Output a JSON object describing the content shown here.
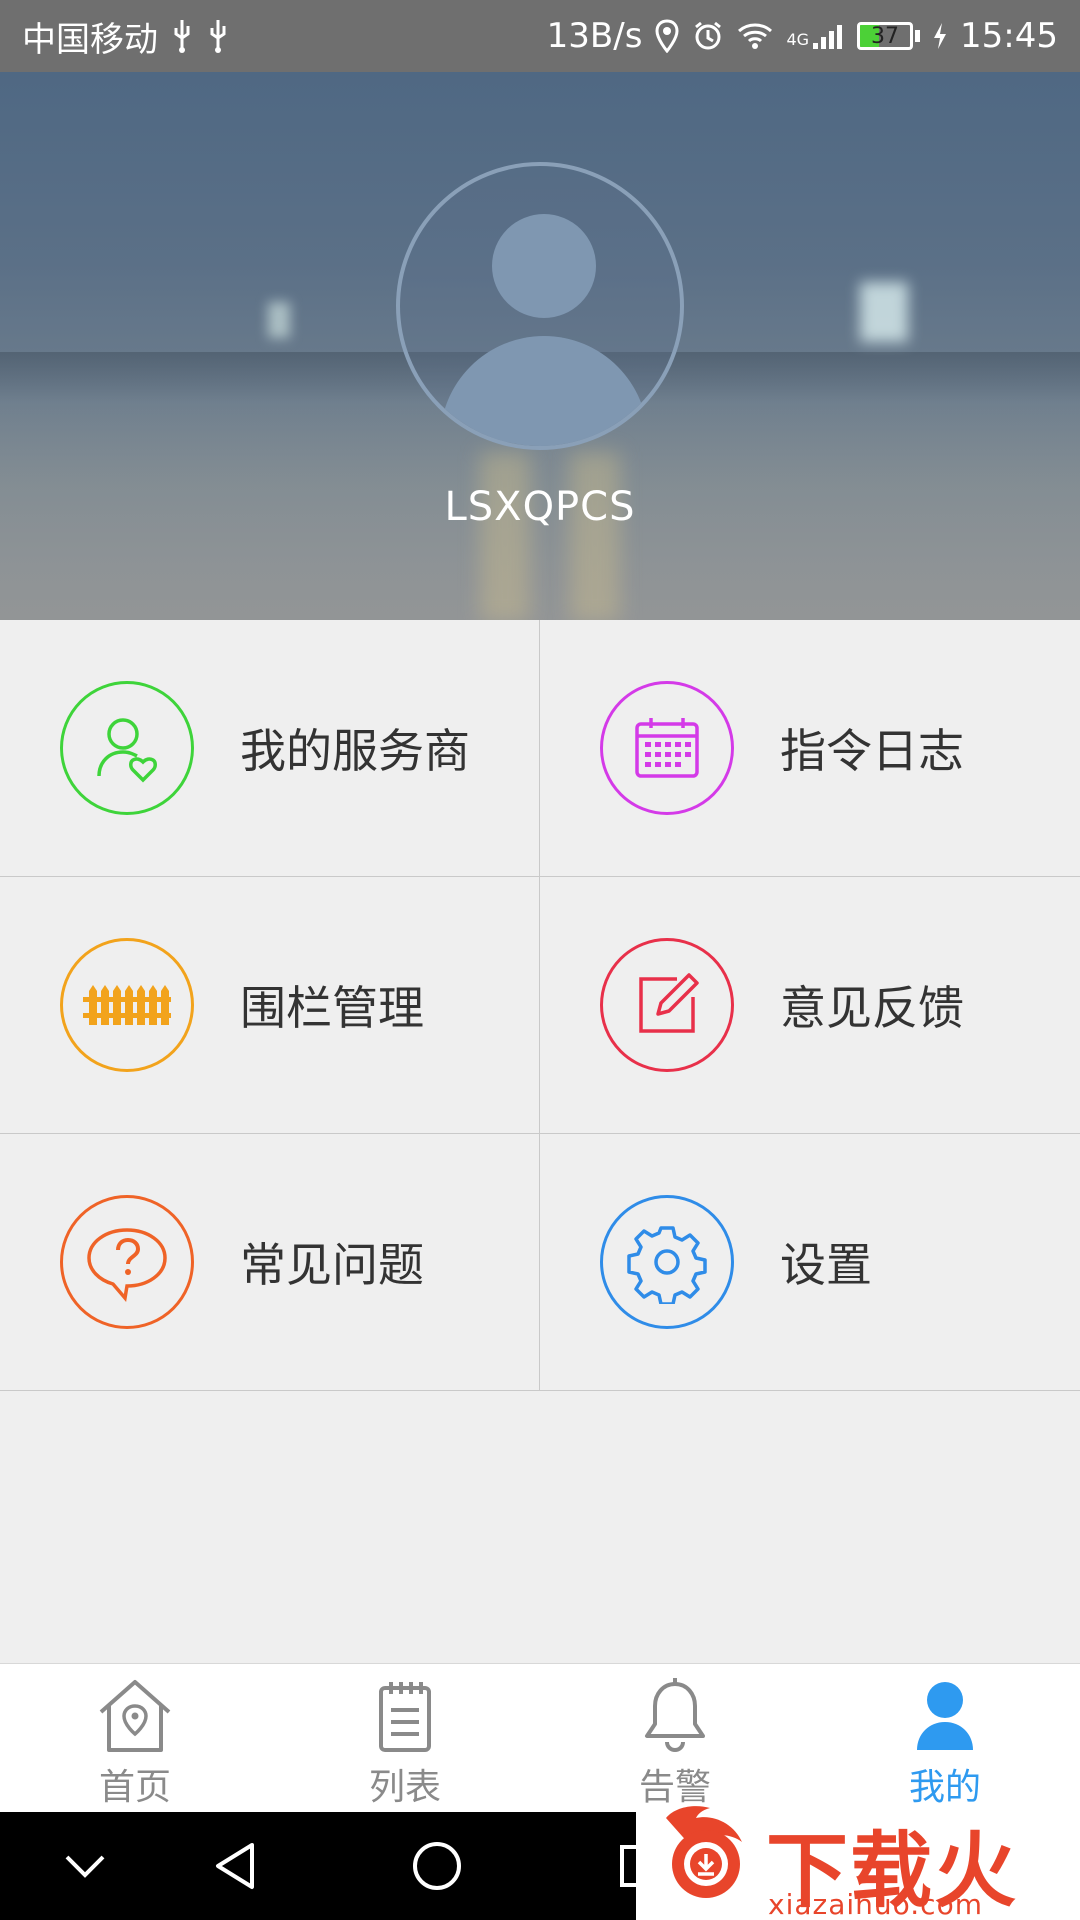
{
  "status_bar": {
    "carrier": "中国移动",
    "net_speed": "13B/s",
    "network_type": "4G",
    "battery": "37",
    "time": "15:45"
  },
  "profile": {
    "username": "LSXQPCS"
  },
  "menu": [
    {
      "label": "我的服务商",
      "icon": "user-heart-icon",
      "color": "#3ed43a"
    },
    {
      "label": "指令日志",
      "icon": "calendar-icon",
      "color": "#d43ae8"
    },
    {
      "label": "围栏管理",
      "icon": "fence-icon",
      "color": "#f2a31c"
    },
    {
      "label": "意见反馈",
      "icon": "edit-icon",
      "color": "#e8304a"
    },
    {
      "label": "常见问题",
      "icon": "question-bubble-icon",
      "color": "#ef6327"
    },
    {
      "label": "设置",
      "icon": "gear-icon",
      "color": "#2f8ce8"
    }
  ],
  "bottom_nav": [
    {
      "label": "首页",
      "icon": "home-location-icon",
      "active": false
    },
    {
      "label": "列表",
      "icon": "list-icon",
      "active": false
    },
    {
      "label": "告警",
      "icon": "bell-icon",
      "active": false
    },
    {
      "label": "我的",
      "icon": "person-icon",
      "active": true
    }
  ],
  "colors": {
    "accent": "#2e9af0",
    "inactive": "#8a8a8a"
  },
  "watermark": {
    "brand": "下载火",
    "url": "xiazaihuo.com"
  }
}
